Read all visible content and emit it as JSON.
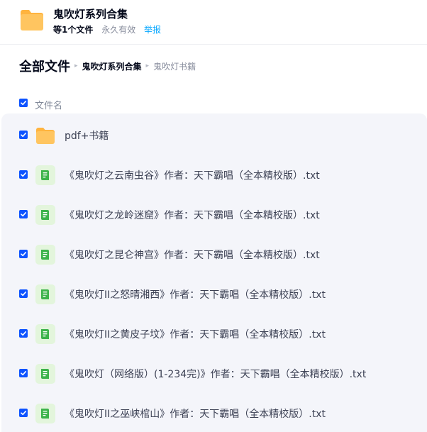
{
  "share": {
    "title": "鬼吹灯系列合集",
    "file_count": "等1个文件",
    "validity": "永久有效",
    "report_link": "举报"
  },
  "breadcrumb": {
    "root": "全部文件",
    "separator": "▸",
    "parent": "鬼吹灯系列合集",
    "current": "鬼吹灯书籍"
  },
  "list_header": {
    "column_name": "文件名",
    "select_all_checked": true
  },
  "files": [
    {
      "name": "pdf+书籍",
      "type": "folder",
      "icon": "folder-icon",
      "checked": true
    },
    {
      "name": "《鬼吹灯之云南虫谷》作者：天下霸唱（全本精校版）.txt",
      "type": "txt",
      "icon": "text-file-icon",
      "checked": true
    },
    {
      "name": "《鬼吹灯之龙岭迷窟》作者：天下霸唱（全本精校版）.txt",
      "type": "txt",
      "icon": "text-file-icon",
      "checked": true
    },
    {
      "name": "《鬼吹灯之昆仑神宫》作者：天下霸唱（全本精校版）.txt",
      "type": "txt",
      "icon": "text-file-icon",
      "checked": true
    },
    {
      "name": "《鬼吹灯II之怒晴湘西》作者：天下霸唱（全本精校版）.txt",
      "type": "txt",
      "icon": "text-file-icon",
      "checked": true
    },
    {
      "name": "《鬼吹灯II之黄皮子坟》作者：天下霸唱（全本精校版）.txt",
      "type": "txt",
      "icon": "text-file-icon",
      "checked": true
    },
    {
      "name": "《鬼吹灯（网络版）(1-234完)》作者：天下霸唱（全本精校版）.txt",
      "type": "txt",
      "icon": "text-file-icon",
      "checked": true
    },
    {
      "name": "《鬼吹灯II之巫峡棺山》作者：天下霸唱（全本精校版）.txt",
      "type": "txt",
      "icon": "text-file-icon",
      "checked": true
    }
  ],
  "colors": {
    "accent": "#0d53ff",
    "link": "#06a7ff",
    "folder": "#ffc560",
    "txt_icon_bg": "#e3f5dc",
    "txt_icon_fg": "#3cb34a",
    "list_bg": "#f4f5fa"
  }
}
